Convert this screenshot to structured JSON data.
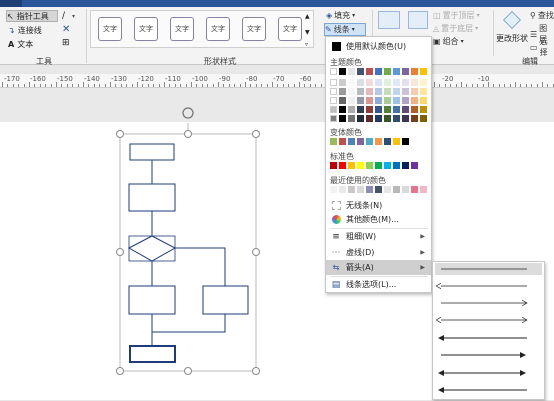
{
  "ribbon": {
    "tools": {
      "pointer_label": "指针工具",
      "connector_label": "连接线",
      "text_label": "文本",
      "group_label": "工具"
    },
    "shape_styles": {
      "swatch_labels": [
        "文字",
        "文字",
        "文字",
        "文字",
        "文字",
        "文字"
      ],
      "group_label": "形状样式"
    },
    "fill_label": "填充",
    "line_label": "线条",
    "arrange": {
      "bring_front_label": "置于顶层",
      "send_back_label": "置于底层",
      "group_label_btn": "组合",
      "arrange_label": "排列",
      "position_label": "位置"
    },
    "change_shape_label": "更改形状",
    "find_label": "查找",
    "layer_label": "图层",
    "select_label": "选择",
    "edit_group_label": "编辑"
  },
  "ruler": {
    "labels": [
      "-170",
      "-160",
      "-150",
      "-140",
      "-130",
      "-120",
      "-110",
      "-100",
      "-90",
      "-80",
      "-70",
      "-60",
      "-50",
      "-40",
      "-30",
      "-20",
      "-10"
    ]
  },
  "menu": {
    "use_default_label": "使用默认颜色(U)",
    "theme_colors_label": "主题颜色",
    "variant_colors_label": "变体颜色",
    "standard_colors_label": "标准色",
    "recent_colors_label": "最近使用的颜色",
    "no_line_label": "无线条(N)",
    "more_colors_label": "其他颜色(M)...",
    "weight_label": "粗细(W)",
    "dash_label": "虚线(D)",
    "arrows_label": "箭头(A)",
    "line_options_label": "线条选项(L)...",
    "theme_top_row": [
      "#ffffff",
      "#000000",
      "#e7e6e6",
      "#44546a",
      "#c0504d",
      "#4472c4",
      "#70ad47",
      "#5b9bd5",
      "#8064a2",
      "#ed7d31",
      "#ffc000"
    ],
    "variant_row": [
      "#9bbb59",
      "#c0504d",
      "#4f81bd",
      "#8064a2",
      "#4bacc6",
      "#f79646",
      "#2c4d75",
      "#ffc000",
      "#000000"
    ],
    "standard_row": [
      "#c00000",
      "#ff0000",
      "#ffc000",
      "#ffff00",
      "#92d050",
      "#00b050",
      "#00b0f0",
      "#0070c0",
      "#002060",
      "#7030a0"
    ],
    "recent_row": [
      "#f2f2f2",
      "#eaeaea",
      "#c8c8c8",
      "#d9d9d9",
      "#8c8cb8",
      "#44546a",
      "#e6e6e6",
      "#b8b8b8",
      "#d9d9d9",
      "#e8738c",
      "#f4b6c2"
    ]
  },
  "colors": {
    "ribbon_bg": "#f3f3f3",
    "title_bar": "#2b579a",
    "shape_stroke": "#1f3b7a",
    "menu_highlight": "#cfcfcf"
  }
}
